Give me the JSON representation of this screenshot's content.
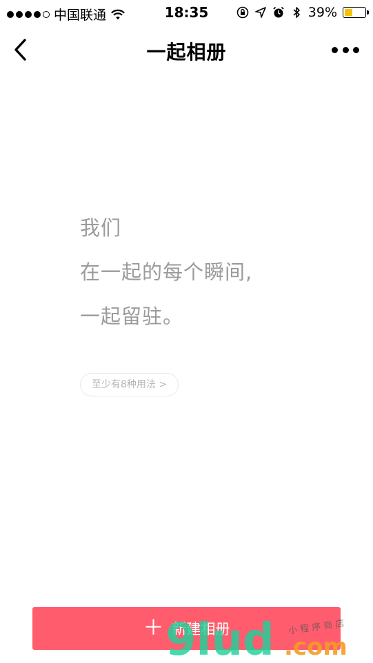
{
  "status_bar": {
    "carrier": "中国联通",
    "time": "18:35",
    "battery_percent": "39%",
    "battery_level": 0.39,
    "battery_color": "#f6c100",
    "icons": [
      "signal-icon",
      "wifi-icon",
      "orientation-lock-icon",
      "location-icon",
      "alarm-icon",
      "bluetooth-icon",
      "battery-icon"
    ]
  },
  "nav": {
    "title": "一起相册",
    "back_icon": "chevron-left-icon",
    "more_icon": "more-dots-icon"
  },
  "intro": {
    "line1": "我们",
    "line2": "在一起的每个瞬间,",
    "line3": "一起留驻。"
  },
  "usage_link": {
    "label": "至少有8种用法 >"
  },
  "create_button": {
    "label": "新建相册",
    "icon": "plus-icon",
    "color": "#ff5c6e"
  },
  "watermark": {
    "brand": "9lud",
    "suffix": ".com",
    "caption": "小 程 序 商 店"
  }
}
